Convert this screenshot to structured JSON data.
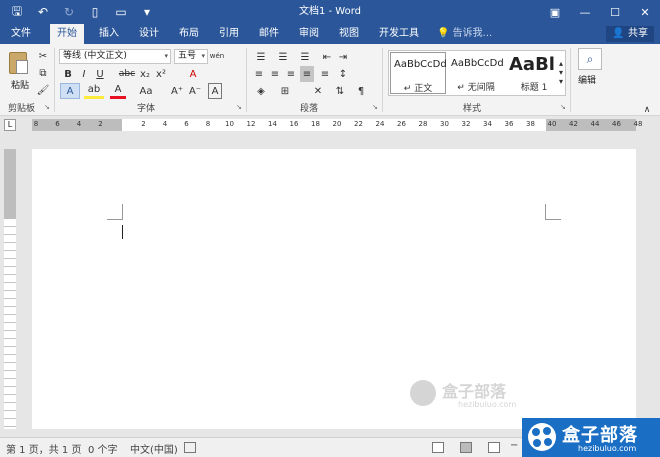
{
  "titlebar": {
    "title": "文档1 - Word",
    "qat": {
      "save_icon": "save-icon",
      "undo_icon": "undo-icon",
      "redo_icon": "redo-icon",
      "new_icon": "new-document-icon",
      "open_icon": "open-icon",
      "customize_icon": "chevron-down-icon"
    },
    "window": {
      "restore_ribbon": "ribbon-display-icon",
      "minimize": "minimize-icon",
      "maximize": "maximize-icon",
      "close": "close-icon"
    }
  },
  "tabs": [
    {
      "label": "文件"
    },
    {
      "label": "开始"
    },
    {
      "label": "插入"
    },
    {
      "label": "设计"
    },
    {
      "label": "布局"
    },
    {
      "label": "引用"
    },
    {
      "label": "邮件"
    },
    {
      "label": "审阅"
    },
    {
      "label": "视图"
    },
    {
      "label": "开发工具"
    }
  ],
  "active_tab_index": 1,
  "tell_me": "告诉我...",
  "share": "共享",
  "ribbon": {
    "clipboard": {
      "paste": "粘贴",
      "group": "剪贴板"
    },
    "font": {
      "group": "字体",
      "font_name": "等线 (中文正文)",
      "font_size": "五号",
      "phonetic": "wén",
      "bold": "B",
      "italic": "I",
      "underline": "U",
      "strike": "abc",
      "subscript": "x₂",
      "superscript": "x²",
      "text_effects": "A",
      "highlight": "ab",
      "font_color": "A",
      "change_case": "Aa",
      "grow": "A⁺",
      "shrink": "A⁻",
      "clear": "A",
      "char_border": "A"
    },
    "paragraph": {
      "group": "段落"
    },
    "styles": {
      "group": "样式",
      "items": [
        {
          "sample": "AaBbCcDd",
          "name": "↵ 正文"
        },
        {
          "sample": "AaBbCcDd",
          "name": "↵ 无间隔"
        },
        {
          "sample": "AaBl",
          "name": "标题 1"
        }
      ]
    },
    "editing": {
      "label": "编辑"
    }
  },
  "ruler": {
    "numbers": [
      "8",
      "6",
      "4",
      "2",
      "",
      "2",
      "4",
      "6",
      "8",
      "10",
      "12",
      "14",
      "16",
      "18",
      "20",
      "22",
      "24",
      "26",
      "28",
      "30",
      "32",
      "34",
      "36",
      "38",
      "40",
      "42",
      "44",
      "46",
      "48"
    ]
  },
  "watermark": {
    "text": "盒子部落",
    "sub": "hezibuluo.com"
  },
  "statusbar": {
    "pages": "第 1 页，共 1 页",
    "words": "0 个字",
    "language": "中文(中国)"
  },
  "logo": {
    "text": "盒子部落",
    "sub": "hezibuluo.com"
  },
  "colors": {
    "accent": "#2b579a",
    "ribbon_bg": "#f3f3f3",
    "logo_bg": "#1a6fc5"
  }
}
